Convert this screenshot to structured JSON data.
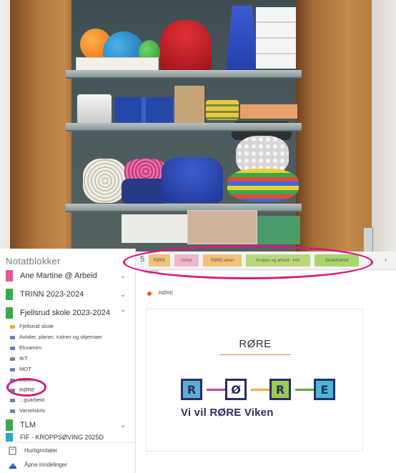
{
  "sidebar": {
    "header": "Notatblokker",
    "notebooks": [
      {
        "label": "Ane Martine @ Arbeid",
        "color": "#e0579a",
        "expanded": false
      },
      {
        "label": "TRINN 2023-2024",
        "color": "#3aa84a",
        "expanded": false
      },
      {
        "label": "Fjellsrud skole 2023-2024",
        "color": "#3aa84a",
        "expanded": true
      }
    ],
    "sections": [
      {
        "label": "Fjellsrud skole",
        "icon": "yellow-section-icon"
      },
      {
        "label": "Avtaler, planer, rutiner og skjemaer",
        "icon": "section-icon"
      },
      {
        "label": "Eksamen",
        "icon": "section-icon"
      },
      {
        "label": "IKT",
        "icon": "section-icon"
      },
      {
        "label": "MOT",
        "icon": "section-icon"
      },
      {
        "label": "Møter",
        "icon": "section-icon"
      },
      {
        "label": "RØRE",
        "icon": "section-icon"
      },
      {
        "label": "...gsarbeid",
        "icon": "section-icon"
      },
      {
        "label": "Varselskriv",
        "icon": "section-icon"
      }
    ],
    "notebook_tlm": {
      "label": "TLM",
      "color": "#3aa84a"
    },
    "notebook_cut": {
      "label": "FIF - KROPPSØVING 2025D",
      "color": "#2aa7c9"
    },
    "bottom_links": [
      {
        "label": "Hurtignotater",
        "icon": "quick-notes-icon"
      },
      {
        "label": "Åpne inndelinger",
        "icon": "open-sections-icon"
      }
    ],
    "chevron_down": "⌄",
    "chevron_up": "⌃"
  },
  "tabs": {
    "nav_symbol": "5",
    "more_symbol": "›",
    "items": [
      {
        "label": "RØRE",
        "color": "#f1c27a"
      },
      {
        "label": "Utstyr",
        "color": "#f2b6c8"
      },
      {
        "label": "RØRE-økter",
        "color": "#f1c27a"
      },
      {
        "label": "Kropps og arbeid - info",
        "color": "#b8d97a"
      },
      {
        "label": "Skolefriidrett",
        "color": "#a9d66c"
      }
    ]
  },
  "content": {
    "section_title": "RØRE",
    "page_label": "RØRE",
    "card_title": "RØRE",
    "logo_letters": [
      "R",
      "Ø",
      "R",
      "E"
    ],
    "logo_colors": [
      "#5aaed6",
      "#ffffff",
      "#9acb52",
      "#49b6d4"
    ],
    "logo_line_colors": [
      "#c34a8c",
      "#e7b238",
      "#5aa742"
    ],
    "tagline": "Vi vil RØRE Viken"
  },
  "colors": {
    "annotation": "#d8197f",
    "accent_orange": "#e58a3c",
    "logo_navy": "#2a2e62"
  }
}
